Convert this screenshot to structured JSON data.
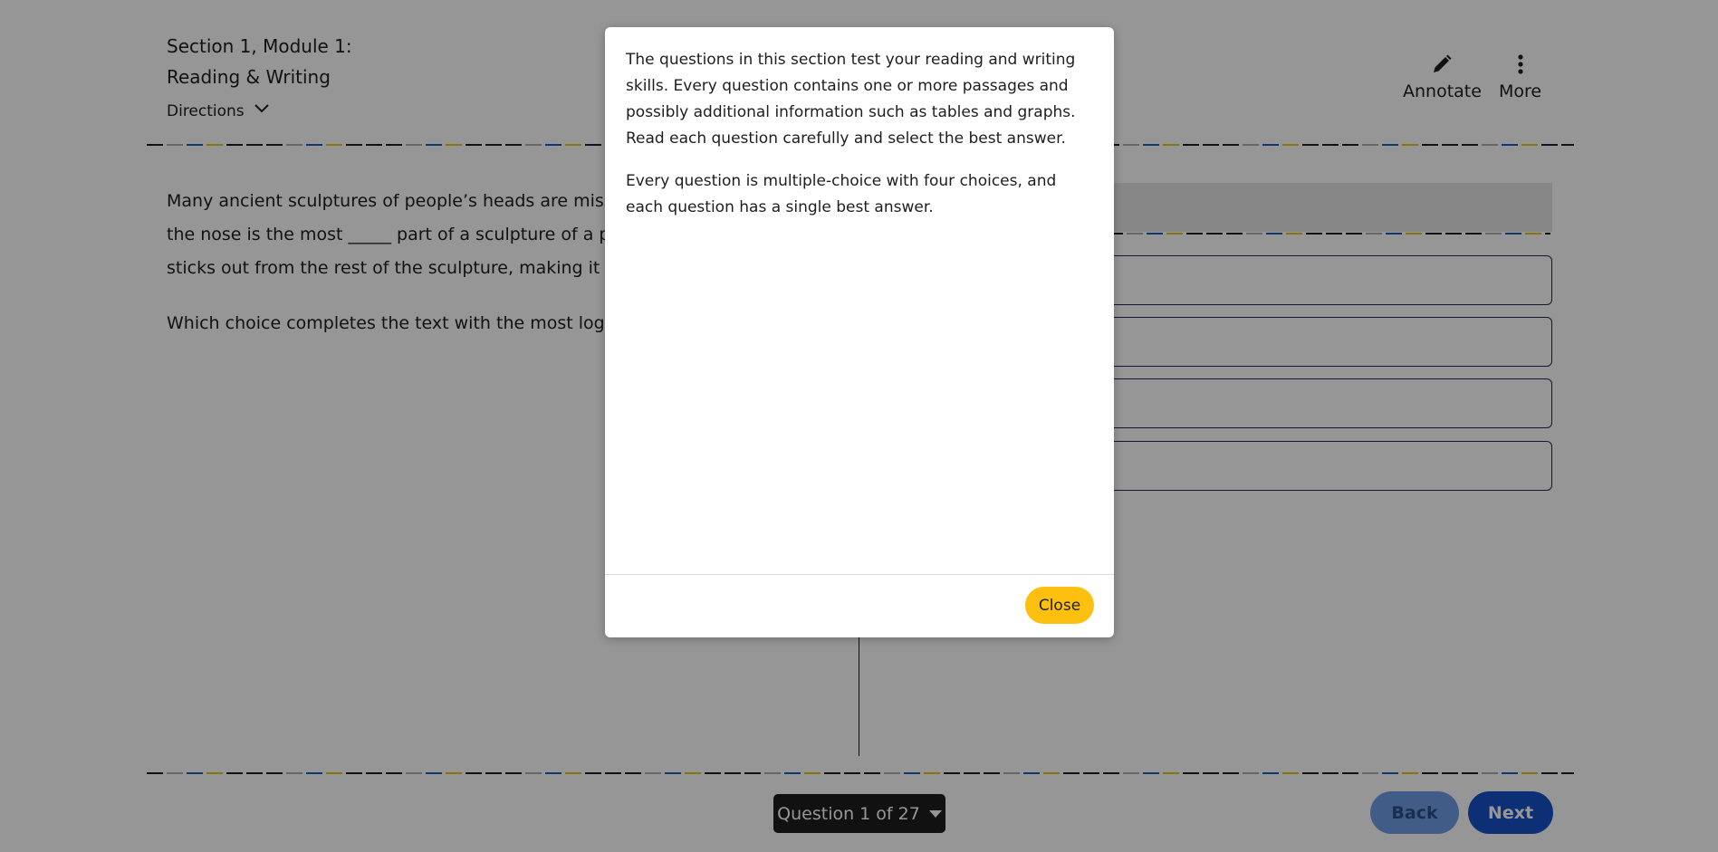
{
  "header": {
    "section_line1": "Section 1, Module 1:",
    "section_line2": "Reading & Writing",
    "directions_label": "Directions",
    "annotate_label": "Annotate",
    "more_label": "More"
  },
  "passage": {
    "line1": "Many ancient sculptures of people’s heads are missing",
    "line2": "the nose is the most _____ part of a sculpture of a pers",
    "line3": "sticks out from the rest of the sculpture, making it espe",
    "prompt": "Which choice completes the text with the most logical"
  },
  "footer": {
    "question_nav_label": "Question 1 of 27",
    "back_label": "Back",
    "next_label": "Next"
  },
  "modal": {
    "paragraph1": "The questions in this section test your reading and writing skills. Every question contains one or more passages and possibly additional information such as tables and graphs. Read each question carefully and select the best answer.",
    "paragraph2": "Every question is multiple-choice with four choices, and each question has a single best answer.",
    "close_label": "Close"
  },
  "colors": {
    "accent_blue": "#1550c7",
    "back_button": "#6f9ee6",
    "close_button": "#fdc010",
    "nav_dark": "#1e1e1e",
    "overlay": "rgba(0,0,0,0.41)"
  },
  "icons": {
    "annotate": "pencil-icon",
    "more": "vertical-dots-icon",
    "directions": "chevron-down-icon",
    "question_nav": "caret-down-icon"
  }
}
